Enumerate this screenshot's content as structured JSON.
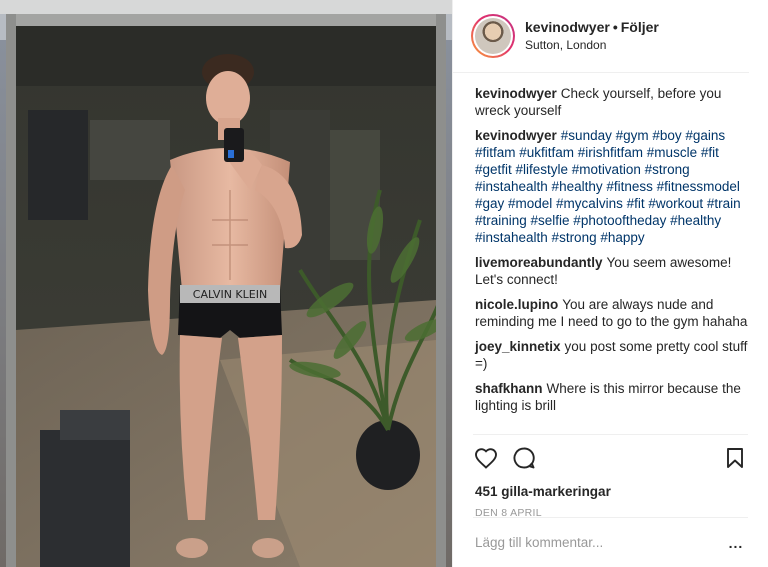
{
  "post": {
    "username": "kevinodwyer",
    "separator": "•",
    "follow_label": "Följer",
    "location": "Sutton, London",
    "caption": "Check yourself, before you wreck yourself"
  },
  "comments": [
    {
      "user": "kevinodwyer",
      "text": "#sunday #gym #boy #gains #fitfam #ukfitfam #irishfitfam #muscle #fit #getfit #lifestyle #motivation #strong #instahealth #healthy #fitness #fitnessmodel #gay #model #mycalvins #fit #workout #train #training #selfie #photooftheday #healthy #instahealth #strong #happy"
    },
    {
      "user": "livemoreabundantly",
      "text": "You seem awesome! Let's connect!"
    },
    {
      "user": "nicole.lupino",
      "text": "You are always nude and reminding me I need to go to the gym hahaha"
    },
    {
      "user": "joey_kinnetix",
      "text": "you post some pretty cool stuff =)"
    },
    {
      "user": "shafkhann",
      "text": "Where is this mirror because the lighting is brill"
    }
  ],
  "actions": {
    "likes": "451 gilla-markeringar",
    "date": "DEN 8 APRIL",
    "icons": [
      "heart-icon",
      "comment-icon",
      "bookmark-icon"
    ]
  },
  "comment_box": {
    "placeholder": "Lägg till kommentar...",
    "more_label": "..."
  },
  "colors": {
    "hashtag": "#003569",
    "text": "#262626",
    "muted": "#999999",
    "divider": "#efefef"
  }
}
